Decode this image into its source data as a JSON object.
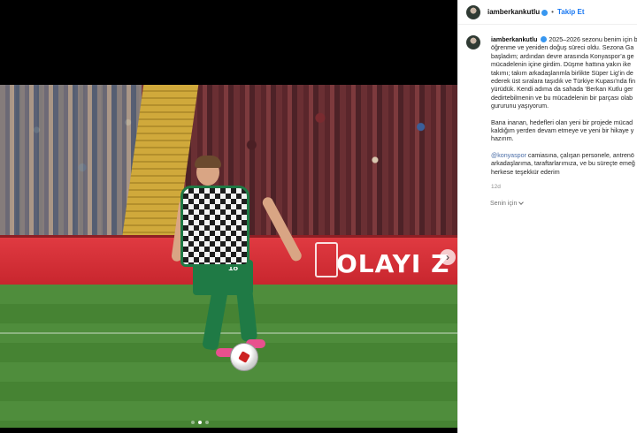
{
  "post": {
    "username": "iamberkankutlu",
    "follow_label": "Takip Et",
    "separator": "•",
    "time_ago": "12d",
    "translation_label": "Senin için",
    "caption": {
      "line1": "2025–2026 sezonu benim için b",
      "line2": "öğrenme ve yeniden doğuş süreci oldu. Sezona Ga",
      "line3": "başladım; ardından devre arasında Konyaspor’a ge",
      "line4": "mücadelenin içine girdim. Düşme hattına yakın ike",
      "line5": "takımı; takım arkadaşlarımla birlikte Süper Lig’in de",
      "line6": "ederek üst sıralara taşıdık ve Türkiye Kupası’nda fin",
      "line7": "yürüdük. Kendi adıma da sahada ‘Berkan Kutlu ger",
      "line8": "dedirtebilmenin ve bu mücadelenin bir parçası olab",
      "line9": "gururunu yaşıyorum.",
      "p2_line1": "Bana inanan, hedefleri olan yeni bir projede mücad",
      "p2_line2": "kaldığım yerden devam etmeye ve yeni bir hikaye y",
      "p2_line3": "hazırım.",
      "p3_mention": "@konyaspor",
      "p3_line1": " camiasına, çalışan personele, antrenö",
      "p3_line2": "arkadaşlarıma, taraftarlarımıza, ve bu süreçte emeğ",
      "p3_line3": "herkese teşekkür ederim"
    }
  },
  "media": {
    "board_text": "OLAYI Z",
    "jersey_number": "18",
    "carousel_dots": 3,
    "active_dot": 1
  },
  "icons": {
    "next": "chevron-right-icon",
    "verified": "verified-badge-icon"
  },
  "colors": {
    "follow": "#1877f2",
    "verified": "#3897f0",
    "mention": "#4a6da7",
    "board": "#d1303a",
    "jersey": "#1f7a45"
  }
}
